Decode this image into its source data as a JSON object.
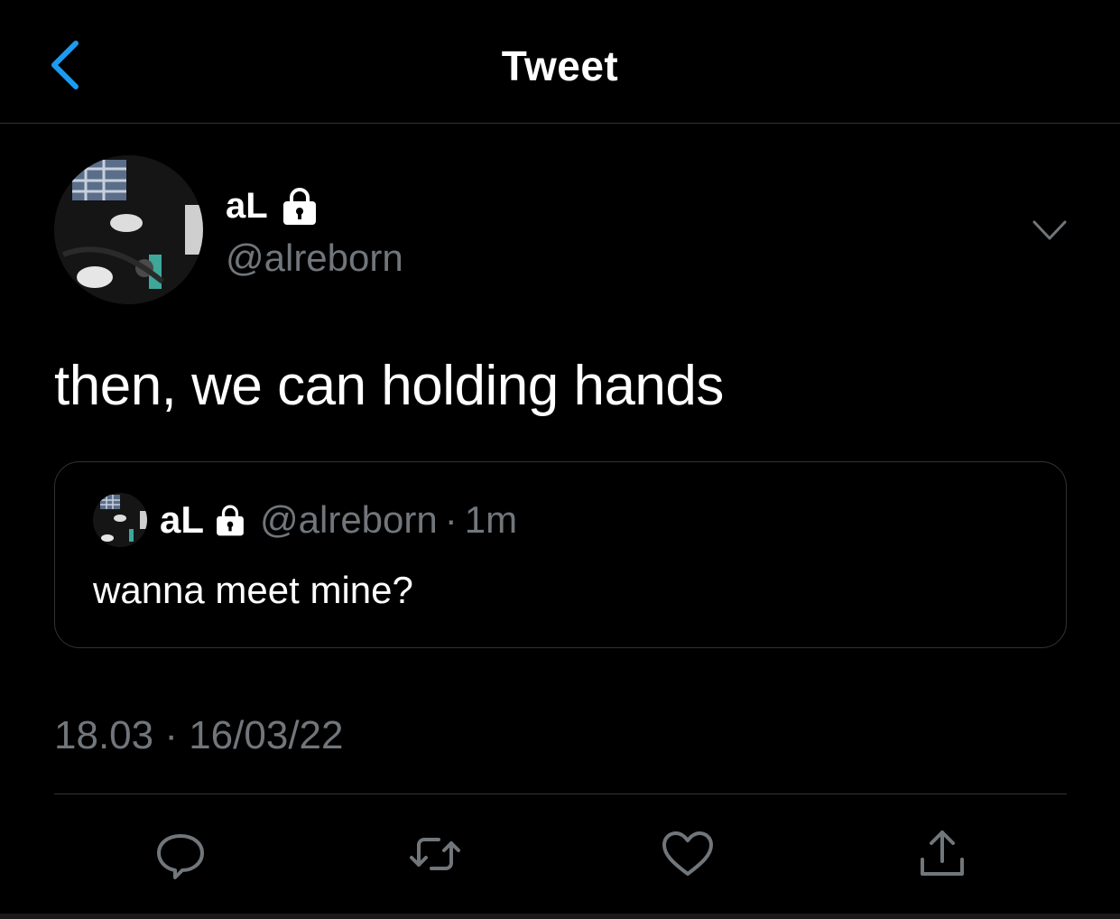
{
  "header": {
    "title": "Tweet"
  },
  "author": {
    "display_name": "aL",
    "handle": "@alreborn"
  },
  "tweet": {
    "text": "then, we can holding hands",
    "timestamp": "18.03 · 16/03/22"
  },
  "quoted_tweet": {
    "display_name": "aL",
    "handle": "@alreborn",
    "separator": "·",
    "time": "1m",
    "text": "wanna meet mine?"
  },
  "icons": {
    "back": "chevron-left-icon",
    "menu": "chevron-down-icon",
    "protected": "lock-icon",
    "reply": "reply-icon",
    "retweet": "retweet-icon",
    "like": "heart-icon",
    "share": "share-icon"
  },
  "colors": {
    "accent": "#1d9bf0",
    "muted": "#71767b",
    "border": "#2f3336",
    "background": "#000000"
  }
}
